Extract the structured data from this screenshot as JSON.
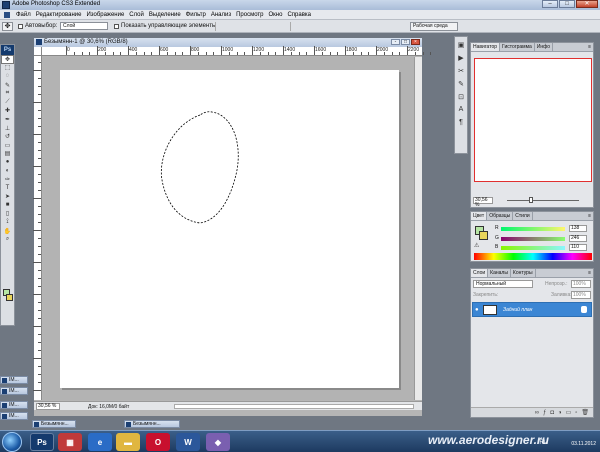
{
  "window": {
    "title": "Adobe Photoshop CS3 Extended",
    "btn_min": "–",
    "btn_max": "□",
    "btn_close": "✕"
  },
  "menu": [
    "Файл",
    "Редактирование",
    "Изображение",
    "Слой",
    "Выделение",
    "Фильтр",
    "Анализ",
    "Просмотр",
    "Окно",
    "Справка"
  ],
  "options": {
    "autoselect_label": "Автовыбор:",
    "autoselect_value": "Слой",
    "show_controls": "Показать управляющие элементы",
    "workspace": "Рабочая среда"
  },
  "document": {
    "name": "Безымянн-1 @ 30,6% (RGB/8)",
    "zoom": "30,56 %",
    "info": "Док: 16,0M/0 байт",
    "ruler_labels": [
      "0",
      "200",
      "400",
      "600",
      "800",
      "1000",
      "1200",
      "1400",
      "1600",
      "1800",
      "2000",
      "2200"
    ]
  },
  "minimized_docs": [
    "IM...",
    "IM...",
    "IM...",
    "IM..."
  ],
  "bottom_docs": [
    "Безымянн...",
    "Безымянн..."
  ],
  "tools": [
    "move-tool",
    "marquee-tool",
    "lasso-tool",
    "quick-select-tool",
    "crop-tool",
    "slice-tool",
    "healing-tool",
    "brush-tool",
    "stamp-tool",
    "history-brush-tool",
    "eraser-tool",
    "gradient-tool",
    "blur-tool",
    "dodge-tool",
    "pen-tool",
    "type-tool",
    "path-select-tool",
    "shape-tool",
    "notes-tool",
    "eyedropper-tool",
    "hand-tool",
    "zoom-tool"
  ],
  "navigator": {
    "tabs": [
      "Навигатор",
      "Гистограмма",
      "Инфо"
    ],
    "zoom": "30,56 %"
  },
  "color": {
    "tabs": [
      "Цвет",
      "Образцы",
      "Стили"
    ],
    "r": "138",
    "g": "246",
    "b": "110",
    "fg": "#b7e6a5",
    "bg": "#e9d55b"
  },
  "layers": {
    "tabs": [
      "Слои",
      "Каналы",
      "Контуры"
    ],
    "mode": "Нормальный",
    "opacity_label": "Непрозр.:",
    "opacity": "100%",
    "lock_label": "Закрепить:",
    "fill_label": "Заливка:",
    "fill": "100%",
    "layer_name": "Задний план"
  },
  "taskbar": {
    "watermark": "www.aerodesigner.ru",
    "date": "03.11.2012",
    "lang": "RU"
  },
  "colors": {
    "selected_layer": "#3b86d4",
    "nav_frame": "#e03030"
  }
}
